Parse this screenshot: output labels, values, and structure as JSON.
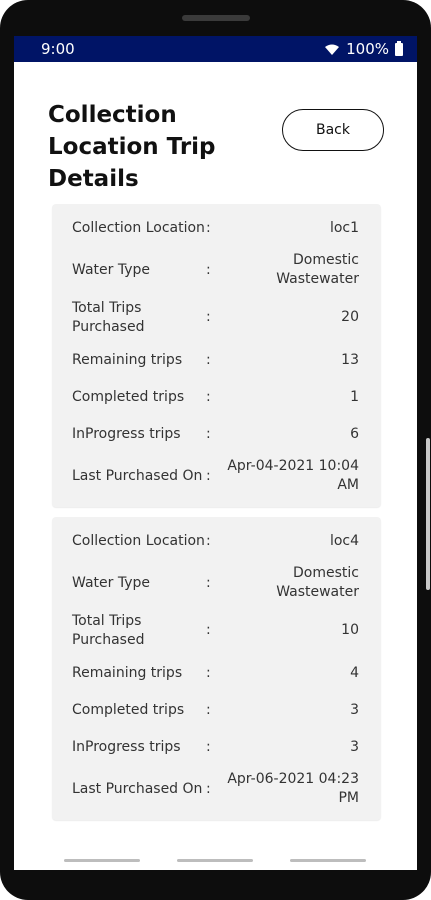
{
  "status": {
    "time": "9:00",
    "battery": "100%"
  },
  "header": {
    "title": "Collection Location Trip Details",
    "back_label": "Back"
  },
  "labels": {
    "collection_location": "Collection Location",
    "water_type": "Water Type",
    "total_trips": "Total Trips Purchased",
    "remaining": "Remaining trips",
    "completed": "Completed trips",
    "inprogress": "InProgress trips",
    "last_purchased": "Last Purchased On",
    "separator": ":"
  },
  "records": [
    {
      "collection_location": "loc1",
      "water_type": "Domestic Wastewater",
      "total_trips": "20",
      "remaining": "13",
      "completed": "1",
      "inprogress": "6",
      "last_purchased": "Apr-04-2021 10:04 AM"
    },
    {
      "collection_location": "loc4",
      "water_type": "Domestic Wastewater",
      "total_trips": "10",
      "remaining": "4",
      "completed": "3",
      "inprogress": "3",
      "last_purchased": "Apr-06-2021 04:23 PM"
    }
  ]
}
